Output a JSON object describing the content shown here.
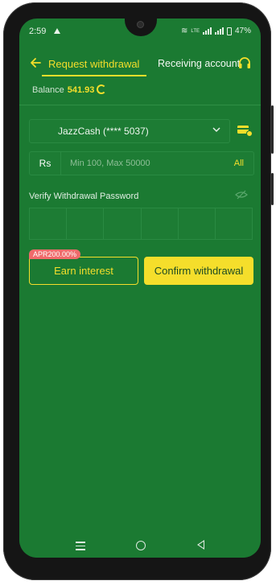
{
  "status_bar": {
    "time": "2:59",
    "network": "LTE",
    "battery": "47%"
  },
  "header": {
    "tab_active": "Request withdrawal",
    "tab_other": "Receiving account"
  },
  "balance": {
    "label": "Balance",
    "value": "541.93"
  },
  "account_select": {
    "selected": "JazzCash (**** 5037)"
  },
  "amount_input": {
    "currency": "Rs",
    "placeholder": "Min 100, Max 50000",
    "all_label": "All"
  },
  "password": {
    "label": "Verify Withdrawal Password",
    "cells": [
      "",
      "",
      "",
      "",
      "",
      ""
    ]
  },
  "actions": {
    "apr_badge": "APR200.00%",
    "earn_label": "Earn interest",
    "confirm_label": "Confirm withdrawal"
  },
  "colors": {
    "background": "#1b7a32",
    "accent": "#f5de2b",
    "badge": "#f06b6b"
  }
}
